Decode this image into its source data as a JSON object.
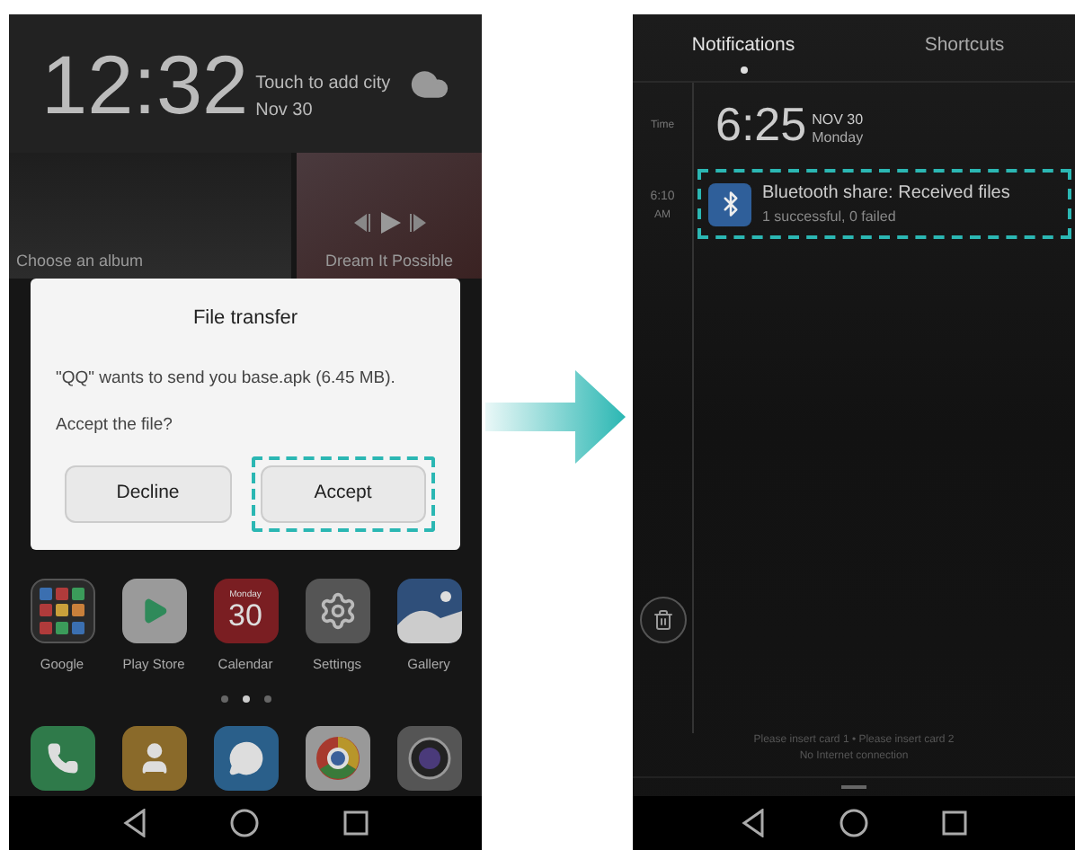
{
  "left_screen": {
    "clock": {
      "time": "12:32",
      "city_hint": "Touch to add city",
      "date": "Nov 30"
    },
    "album_card": {
      "label": "Choose an album"
    },
    "music_card": {
      "title": "Dream It Possible"
    },
    "dialog": {
      "title": "File transfer",
      "message": "\"QQ\" wants to send you base.apk (6.45 MB).",
      "question": "Accept the file?",
      "buttons": [
        {
          "label": "Decline",
          "highlighted": false
        },
        {
          "label": "Accept",
          "highlighted": true
        }
      ]
    },
    "apps": [
      {
        "label": "Google",
        "kind": "folder"
      },
      {
        "label": "Play Store",
        "kind": "store"
      },
      {
        "label": "Calendar",
        "kind": "calendar",
        "icon_day": "Monday",
        "icon_date": "30"
      },
      {
        "label": "Settings",
        "kind": "settings"
      },
      {
        "label": "Gallery",
        "kind": "gallery"
      }
    ],
    "page_dots": [
      {
        "selected": false
      },
      {
        "selected": true
      },
      {
        "selected": false
      }
    ],
    "dock": [
      {
        "kind": "phone"
      },
      {
        "kind": "contacts"
      },
      {
        "kind": "messages"
      },
      {
        "kind": "browser"
      },
      {
        "kind": "camera"
      }
    ]
  },
  "right_screen": {
    "tabs": [
      {
        "label": "Notifications",
        "selected": true
      },
      {
        "label": "Shortcuts",
        "selected": false
      }
    ],
    "time_label": "Time",
    "clock": {
      "time": "6:25",
      "date": "NOV 30",
      "weekday": "Monday"
    },
    "notifications": [
      {
        "time": "6:10",
        "period": "AM",
        "title": "Bluetooth share: Received files",
        "detail": "1 successful, 0 failed",
        "highlighted": true
      }
    ],
    "status_lines": [
      "Please insert card 1 • Please insert card 2",
      "No Internet connection"
    ]
  }
}
